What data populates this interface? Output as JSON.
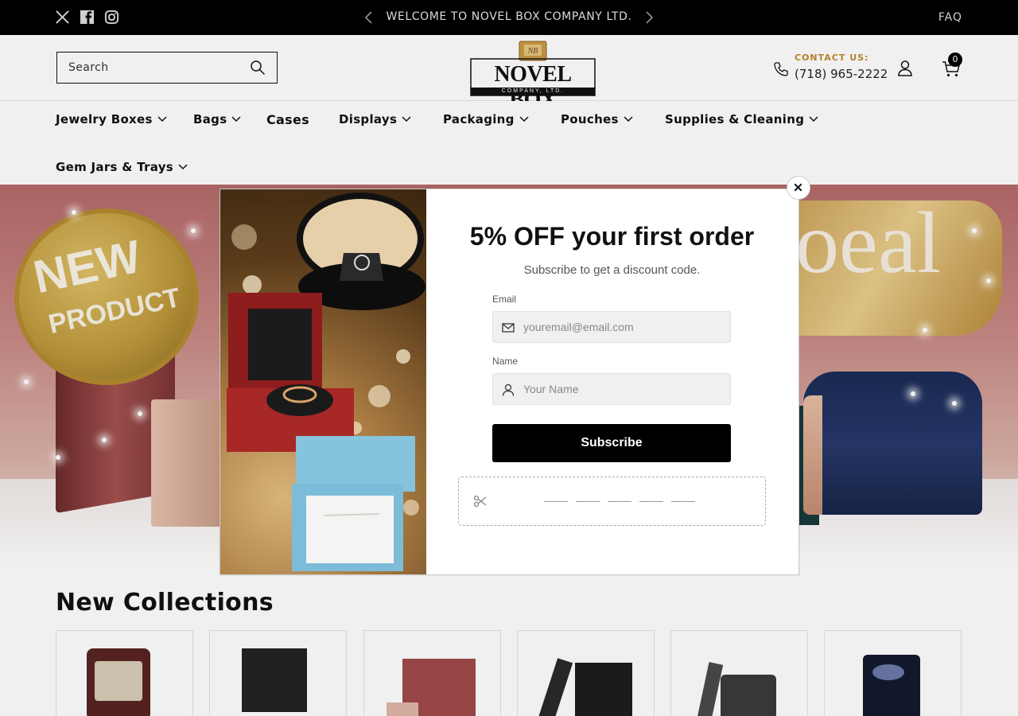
{
  "announcement": {
    "text": "WELCOME TO NOVEL BOX COMPANY LTD.",
    "faq_label": "FAQ"
  },
  "header": {
    "search_label": "Search",
    "logo_main": "NOVEL BOX",
    "logo_sub": "COMPANY, LTD.",
    "contact_label": "CONTACT US:",
    "contact_phone": "(718) 965-2222",
    "cart_count": "0"
  },
  "nav": {
    "items": [
      {
        "label": "Jewelry Boxes"
      },
      {
        "label": "Bags"
      },
      {
        "label": "Cases"
      },
      {
        "label": "Displays"
      },
      {
        "label": "Packaging"
      },
      {
        "label": "Pouches"
      },
      {
        "label": "Supplies & Cleaning"
      },
      {
        "label": "Gem Jars & Trays"
      }
    ]
  },
  "hero": {
    "badge_line1": "NEW",
    "badge_line2": "PRODUCT",
    "ribbon_text": "oeal"
  },
  "collections": {
    "title": "New Collections"
  },
  "popup": {
    "title": "5% OFF your first order",
    "subtitle": "Subscribe to get a discount code.",
    "email_label": "Email",
    "email_placeholder": "youremail@email.com",
    "name_label": "Name",
    "name_placeholder": "Your Name",
    "subscribe_label": "Subscribe"
  },
  "colors": {
    "topbar_bg": "#000000",
    "accent_gold": "#c2882f",
    "button_bg": "#000000"
  }
}
